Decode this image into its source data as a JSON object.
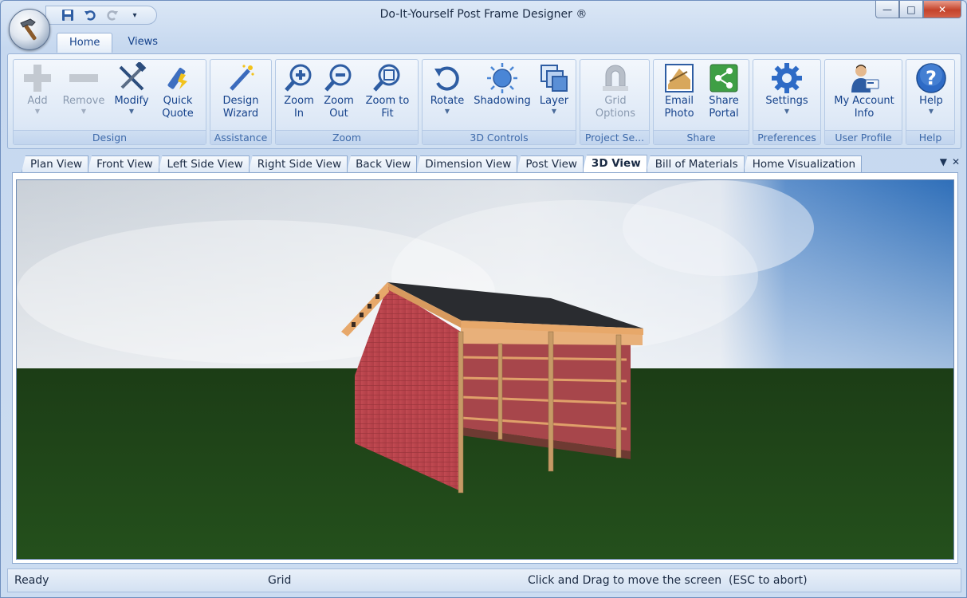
{
  "window": {
    "title": "Do-It-Yourself Post Frame Designer ®",
    "minimize": "—",
    "maximize": "□",
    "close": "✕"
  },
  "qat": {
    "save_icon": "save-icon",
    "undo_icon": "undo-icon",
    "redo_icon": "redo-icon",
    "customize": "▾"
  },
  "ribbon_tabs": [
    {
      "label": "Home",
      "active": true
    },
    {
      "label": "Views",
      "active": false
    }
  ],
  "groups": {
    "design": {
      "label": "Design",
      "add": "Add",
      "remove": "Remove",
      "modify": "Modify",
      "quick_quote_1": "Quick",
      "quick_quote_2": "Quote"
    },
    "assistance": {
      "label": "Assistance",
      "design_wizard_1": "Design",
      "design_wizard_2": "Wizard"
    },
    "zoom": {
      "label": "Zoom",
      "zoom_in_1": "Zoom",
      "zoom_in_2": "In",
      "zoom_out_1": "Zoom",
      "zoom_out_2": "Out",
      "zoom_fit_1": "Zoom to",
      "zoom_fit_2": "Fit"
    },
    "controls3d": {
      "label": "3D Controls",
      "rotate": "Rotate",
      "shadowing": "Shadowing",
      "layer": "Layer"
    },
    "project": {
      "label": "Project Se...",
      "grid_options_1": "Grid",
      "grid_options_2": "Options"
    },
    "share": {
      "label": "Share",
      "email_photo_1": "Email",
      "email_photo_2": "Photo",
      "share_portal_1": "Share",
      "share_portal_2": "Portal"
    },
    "preferences": {
      "label": "Preferences",
      "settings": "Settings"
    },
    "user_profile": {
      "label": "User Profile",
      "my_account_1": "My Account",
      "my_account_2": "Info"
    },
    "help": {
      "label": "Help",
      "help": "Help"
    }
  },
  "view_tabs": [
    {
      "label": "Plan View",
      "active": false
    },
    {
      "label": "Front View",
      "active": false
    },
    {
      "label": "Left Side View",
      "active": false
    },
    {
      "label": "Right Side View",
      "active": false
    },
    {
      "label": "Back View",
      "active": false
    },
    {
      "label": "Dimension View",
      "active": false
    },
    {
      "label": "Post View",
      "active": false
    },
    {
      "label": "3D View",
      "active": true
    },
    {
      "label": "Bill of Materials",
      "active": false
    },
    {
      "label": "Home Visualization",
      "active": false
    }
  ],
  "view_tab_controls": {
    "dropdown": "▼",
    "close": "✕"
  },
  "status": {
    "ready": "Ready",
    "grid": "Grid",
    "hint": "Click and Drag to move the screen  (ESC to abort)"
  },
  "colors": {
    "accent": "#15428b",
    "barn_red": "#b9444b",
    "grass": "#1f4318",
    "sky": "#3f7fc7"
  }
}
